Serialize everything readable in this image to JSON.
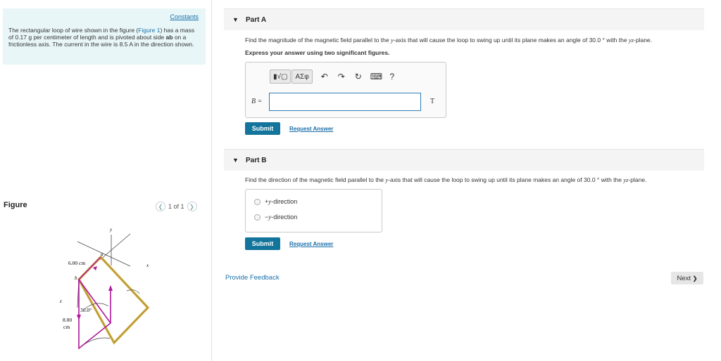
{
  "intro": {
    "constants_link": "Constants",
    "text_1": "The rectangular loop of wire shown in the figure (",
    "figure_link": "Figure 1",
    "text_2": ") has a mass of 0.17 g per centimeter of length and is pivoted about side",
    "side": "ab",
    "text_3": " on a frictionless axis. The current in the wire is 8.5 ",
    "current_unit": "A",
    "text_4": " in the direction shown."
  },
  "figure_panel": {
    "label": "Figure",
    "pager_text": "1 of 1",
    "labels": {
      "y": "y",
      "x": "x",
      "z": "z",
      "a": "a",
      "b": "b",
      "dim1": "6.00 cm",
      "dim2a": "8.00",
      "dim2b": "cm",
      "angle": "30.0°"
    }
  },
  "part_a": {
    "label": "Part A",
    "question_1": "Find the magnitude of the magnetic field parallel to the ",
    "axis": "y",
    "question_2": "-axis that will cause the loop to swing up until its plane makes an angle of 30.0 ",
    "degree": "°",
    "question_3": " with the ",
    "plane": "yz",
    "question_4": "-plane.",
    "instruction": "Express your answer using two significant figures.",
    "toolbar": {
      "templates": "▮√▢",
      "symbols": "ΑΣφ",
      "undo": "↶",
      "redo": "↷",
      "reset": "↻",
      "keyboard": "⌨",
      "help": "?"
    },
    "input_label": "B =",
    "input_value": "",
    "unit": "T",
    "submit": "Submit",
    "request_answer": "Request Answer"
  },
  "part_b": {
    "label": "Part B",
    "question_1": "Find the direction of the magnetic field parallel to the ",
    "axis": "y",
    "question_2": "-axis that will cause the loop to swing up until its plane makes an angle of 30.0 ",
    "degree": "°",
    "question_3": " with the ",
    "plane": "yz",
    "question_4": "-plane.",
    "options": [
      {
        "sign": "+",
        "axis": "y",
        "suffix": "-direction"
      },
      {
        "sign": "−",
        "axis": "y",
        "suffix": "-direction"
      }
    ],
    "submit": "Submit",
    "request_answer": "Request Answer"
  },
  "footer": {
    "feedback": "Provide Feedback",
    "next": "Next",
    "next_icon": "❯"
  },
  "colors": {
    "accent": "#13759c",
    "link": "#1a6fa8",
    "intro_bg": "#e8f6f8",
    "loop_magenta": "#b0179b",
    "loop_gold": "#d9b64a"
  }
}
